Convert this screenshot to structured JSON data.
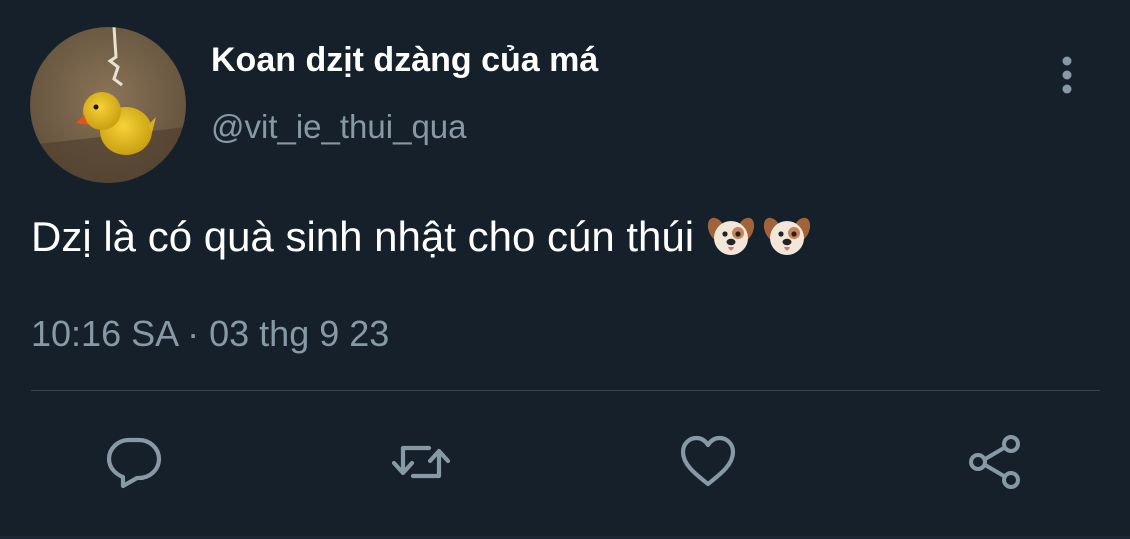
{
  "tweet": {
    "author": {
      "display_name": "Koan dzịt dzàng của má",
      "handle": "@vit_ie_thui_qua"
    },
    "text": "Dzị là có quà sinh nhật cho cún thúi",
    "emojis": [
      "dog-face-emoji",
      "dog-face-emoji"
    ],
    "timestamp": "10:16 SA · 03 thg 9 23"
  },
  "actions": [
    {
      "name": "reply",
      "icon": "comment-icon"
    },
    {
      "name": "retweet",
      "icon": "retweet-icon"
    },
    {
      "name": "like",
      "icon": "heart-icon"
    },
    {
      "name": "share",
      "icon": "share-icon"
    }
  ],
  "colors": {
    "background": "#15202b",
    "primary_text": "#ffffff",
    "secondary_text": "#8899a6",
    "divider": "#38444d"
  }
}
